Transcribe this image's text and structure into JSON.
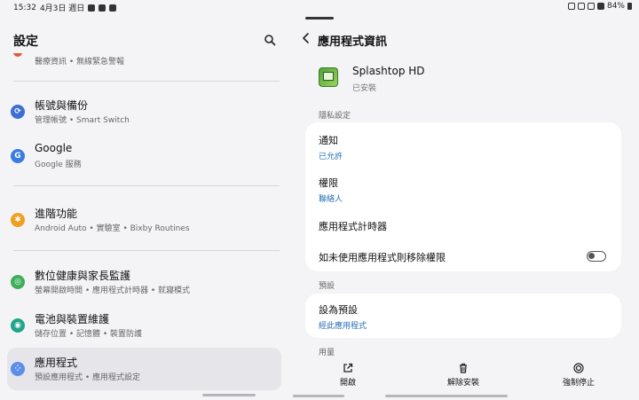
{
  "status_bar": {
    "time": "15:32",
    "date": "4月3日 週日",
    "battery": "84%"
  },
  "left": {
    "title": "設定",
    "faded_subtitle": "醫療資訊 • 無線緊急警報",
    "items": [
      {
        "title": "帳號與備份",
        "subtitle": "管理帳號 • Smart Switch",
        "icon": "sync-icon",
        "color": "#3b6fd4"
      },
      {
        "title": "Google",
        "subtitle": "Google 服務",
        "icon": "google-icon",
        "color": "#3a7be0"
      },
      {
        "title": "進階功能",
        "subtitle": "Android Auto • 實驗室 • Bixby Routines",
        "icon": "gear-plus-icon",
        "color": "#f0a020"
      },
      {
        "title": "數位健康與家長監護",
        "subtitle": "螢幕開啟時間 • 應用程式計時器 • 就寢模式",
        "icon": "wellbeing-icon",
        "color": "#3fae5a"
      },
      {
        "title": "電池與裝置維護",
        "subtitle": "儲存位置 • 記憶體 • 裝置防護",
        "icon": "device-care-icon",
        "color": "#1fa58a"
      },
      {
        "title": "應用程式",
        "subtitle": "預設應用程式 • 應用程式設定",
        "icon": "apps-icon",
        "color": "#5b8ee8"
      }
    ]
  },
  "right": {
    "title": "應用程式資訊",
    "app_name": "Splashtop HD",
    "app_status": "已安裝",
    "privacy_label": "隱私設定",
    "notifications": {
      "title": "通知",
      "value": "已允許"
    },
    "permissions": {
      "title": "權限",
      "value": "聯絡人"
    },
    "app_timer": {
      "title": "應用程式計時器"
    },
    "remove_permissions": {
      "title": "如未使用應用程式則移除權限",
      "enabled": false
    },
    "defaults_label": "預設",
    "set_default": {
      "title": "設為預設",
      "value": "經此應用程式"
    },
    "usage_label": "用量",
    "actions": {
      "open": "開啟",
      "uninstall": "解除安裝",
      "force_stop": "強制停止"
    }
  },
  "colors": {
    "accent_blue": "#2a6fb5",
    "background": "#f4f4f6",
    "card": "#ffffff"
  }
}
